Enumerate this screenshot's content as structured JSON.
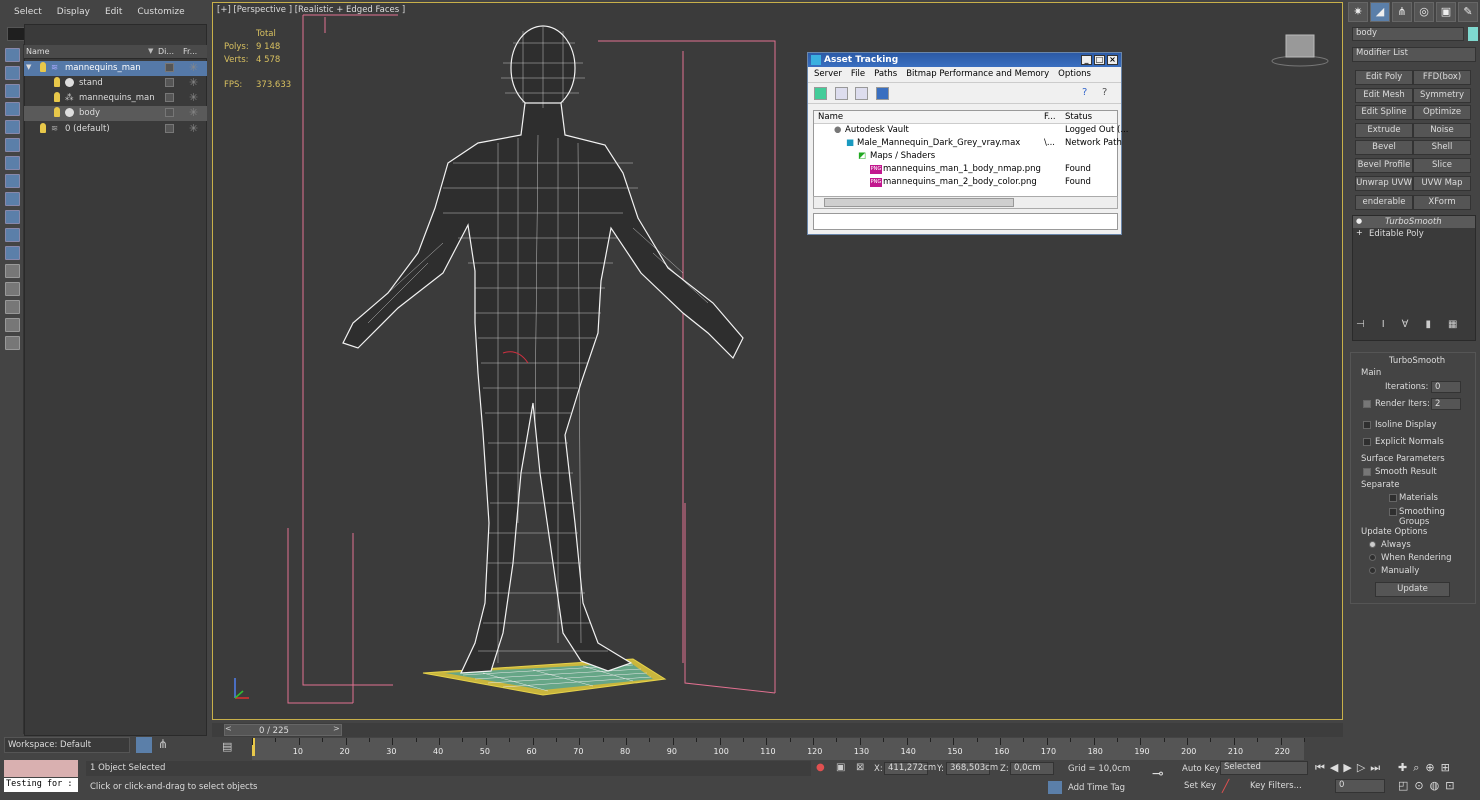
{
  "menu": [
    "Select",
    "Display",
    "Edit",
    "Customize"
  ],
  "scene_explorer": {
    "columns": {
      "name": "Name",
      "display": "Di...",
      "freeze": "Fr..."
    },
    "rows": [
      {
        "label": "mannequins_man",
        "level": 0,
        "selected": true
      },
      {
        "label": "stand",
        "level": 1,
        "selected": false
      },
      {
        "label": "mannequins_man",
        "level": 1,
        "selected": false
      },
      {
        "label": "body",
        "level": 1,
        "selected": false
      },
      {
        "label": "0 (default)",
        "level": 0,
        "selected": false
      }
    ],
    "workspace": "Workspace: Default"
  },
  "viewport": {
    "label": "[+] [Perspective ] [Realistic + Edged Faces ]",
    "stats": {
      "total": "Total",
      "polys_label": "Polys:",
      "polys": "9 148",
      "verts_label": "Verts:",
      "verts": "4 578",
      "fps_label": "FPS:",
      "fps": "373.633"
    }
  },
  "asset_dialog": {
    "title": "Asset Tracking",
    "menu": [
      "Server",
      "File",
      "Paths",
      "Bitmap Performance and Memory",
      "Options"
    ],
    "columns": {
      "name": "Name",
      "f": "F...",
      "status": "Status"
    },
    "rows": [
      {
        "name": "Autodesk Vault",
        "f": "",
        "status": "Logged Out (...",
        "indent": 1
      },
      {
        "name": "Male_Mannequin_Dark_Grey_vray.max",
        "f": "\\...",
        "status": "Network Path",
        "indent": 2
      },
      {
        "name": "Maps / Shaders",
        "f": "",
        "status": "",
        "indent": 3
      },
      {
        "name": "mannequins_man_1_body_nmap.png",
        "f": "",
        "status": "Found",
        "indent": 4
      },
      {
        "name": "mannequins_man_2_body_color.png",
        "f": "",
        "status": "Found",
        "indent": 4
      }
    ]
  },
  "command_panel": {
    "object_name": "body",
    "modifier_list": "Modifier List",
    "buttons": [
      [
        "Edit Poly",
        "FFD(box)"
      ],
      [
        "Edit Mesh",
        "Symmetry"
      ],
      [
        "Edit Spline",
        "Optimize"
      ],
      [
        "Extrude",
        "Noise"
      ],
      [
        "Bevel",
        "Shell"
      ],
      [
        "Bevel Profile",
        "Slice"
      ],
      [
        "Unwrap UVW",
        "UVW Map"
      ],
      [
        "enderable Splin",
        "XForm"
      ]
    ],
    "stack": [
      "TurboSmooth",
      "Editable Poly"
    ],
    "turbosmooth": {
      "title": "TurboSmooth",
      "main": "Main",
      "iterations_label": "Iterations:",
      "iterations": "0",
      "render_iters_label": "Render Iters:",
      "render_iters": "2",
      "isoline": "Isoline Display",
      "explicit": "Explicit Normals",
      "surface": "Surface Parameters",
      "smooth_result": "Smooth Result",
      "separate": "Separate",
      "materials": "Materials",
      "smoothing_groups": "Smoothing Groups",
      "update_options": "Update Options",
      "always": "Always",
      "when_rendering": "When Rendering",
      "manually": "Manually",
      "update": "Update"
    }
  },
  "timeline": {
    "frame": "0 / 225",
    "ticks": [
      "10",
      "20",
      "30",
      "40",
      "50",
      "60",
      "70",
      "80",
      "90",
      "100",
      "110",
      "120",
      "130",
      "140",
      "150",
      "160",
      "170",
      "180",
      "190",
      "200",
      "210",
      "220"
    ]
  },
  "status_bar": {
    "maxscript": "Testing for :",
    "selected": "1 Object Selected",
    "prompt": "Click or click-and-drag to select objects",
    "x_label": "X:",
    "x": "411,272cm",
    "y_label": "Y:",
    "y": "368,503cm",
    "z_label": "Z:",
    "z": "0,0cm",
    "grid": "Grid = 10,0cm",
    "add_time_tag": "Add Time Tag",
    "auto_key": "Auto Key",
    "selected_dd": "Selected",
    "set_key": "Set Key",
    "key_filters": "Key Filters...",
    "frame": "0"
  },
  "colors": {
    "accent": "#5b7fa9",
    "viewport_border": "#c8b04a",
    "stat_text": "#d8c060"
  }
}
